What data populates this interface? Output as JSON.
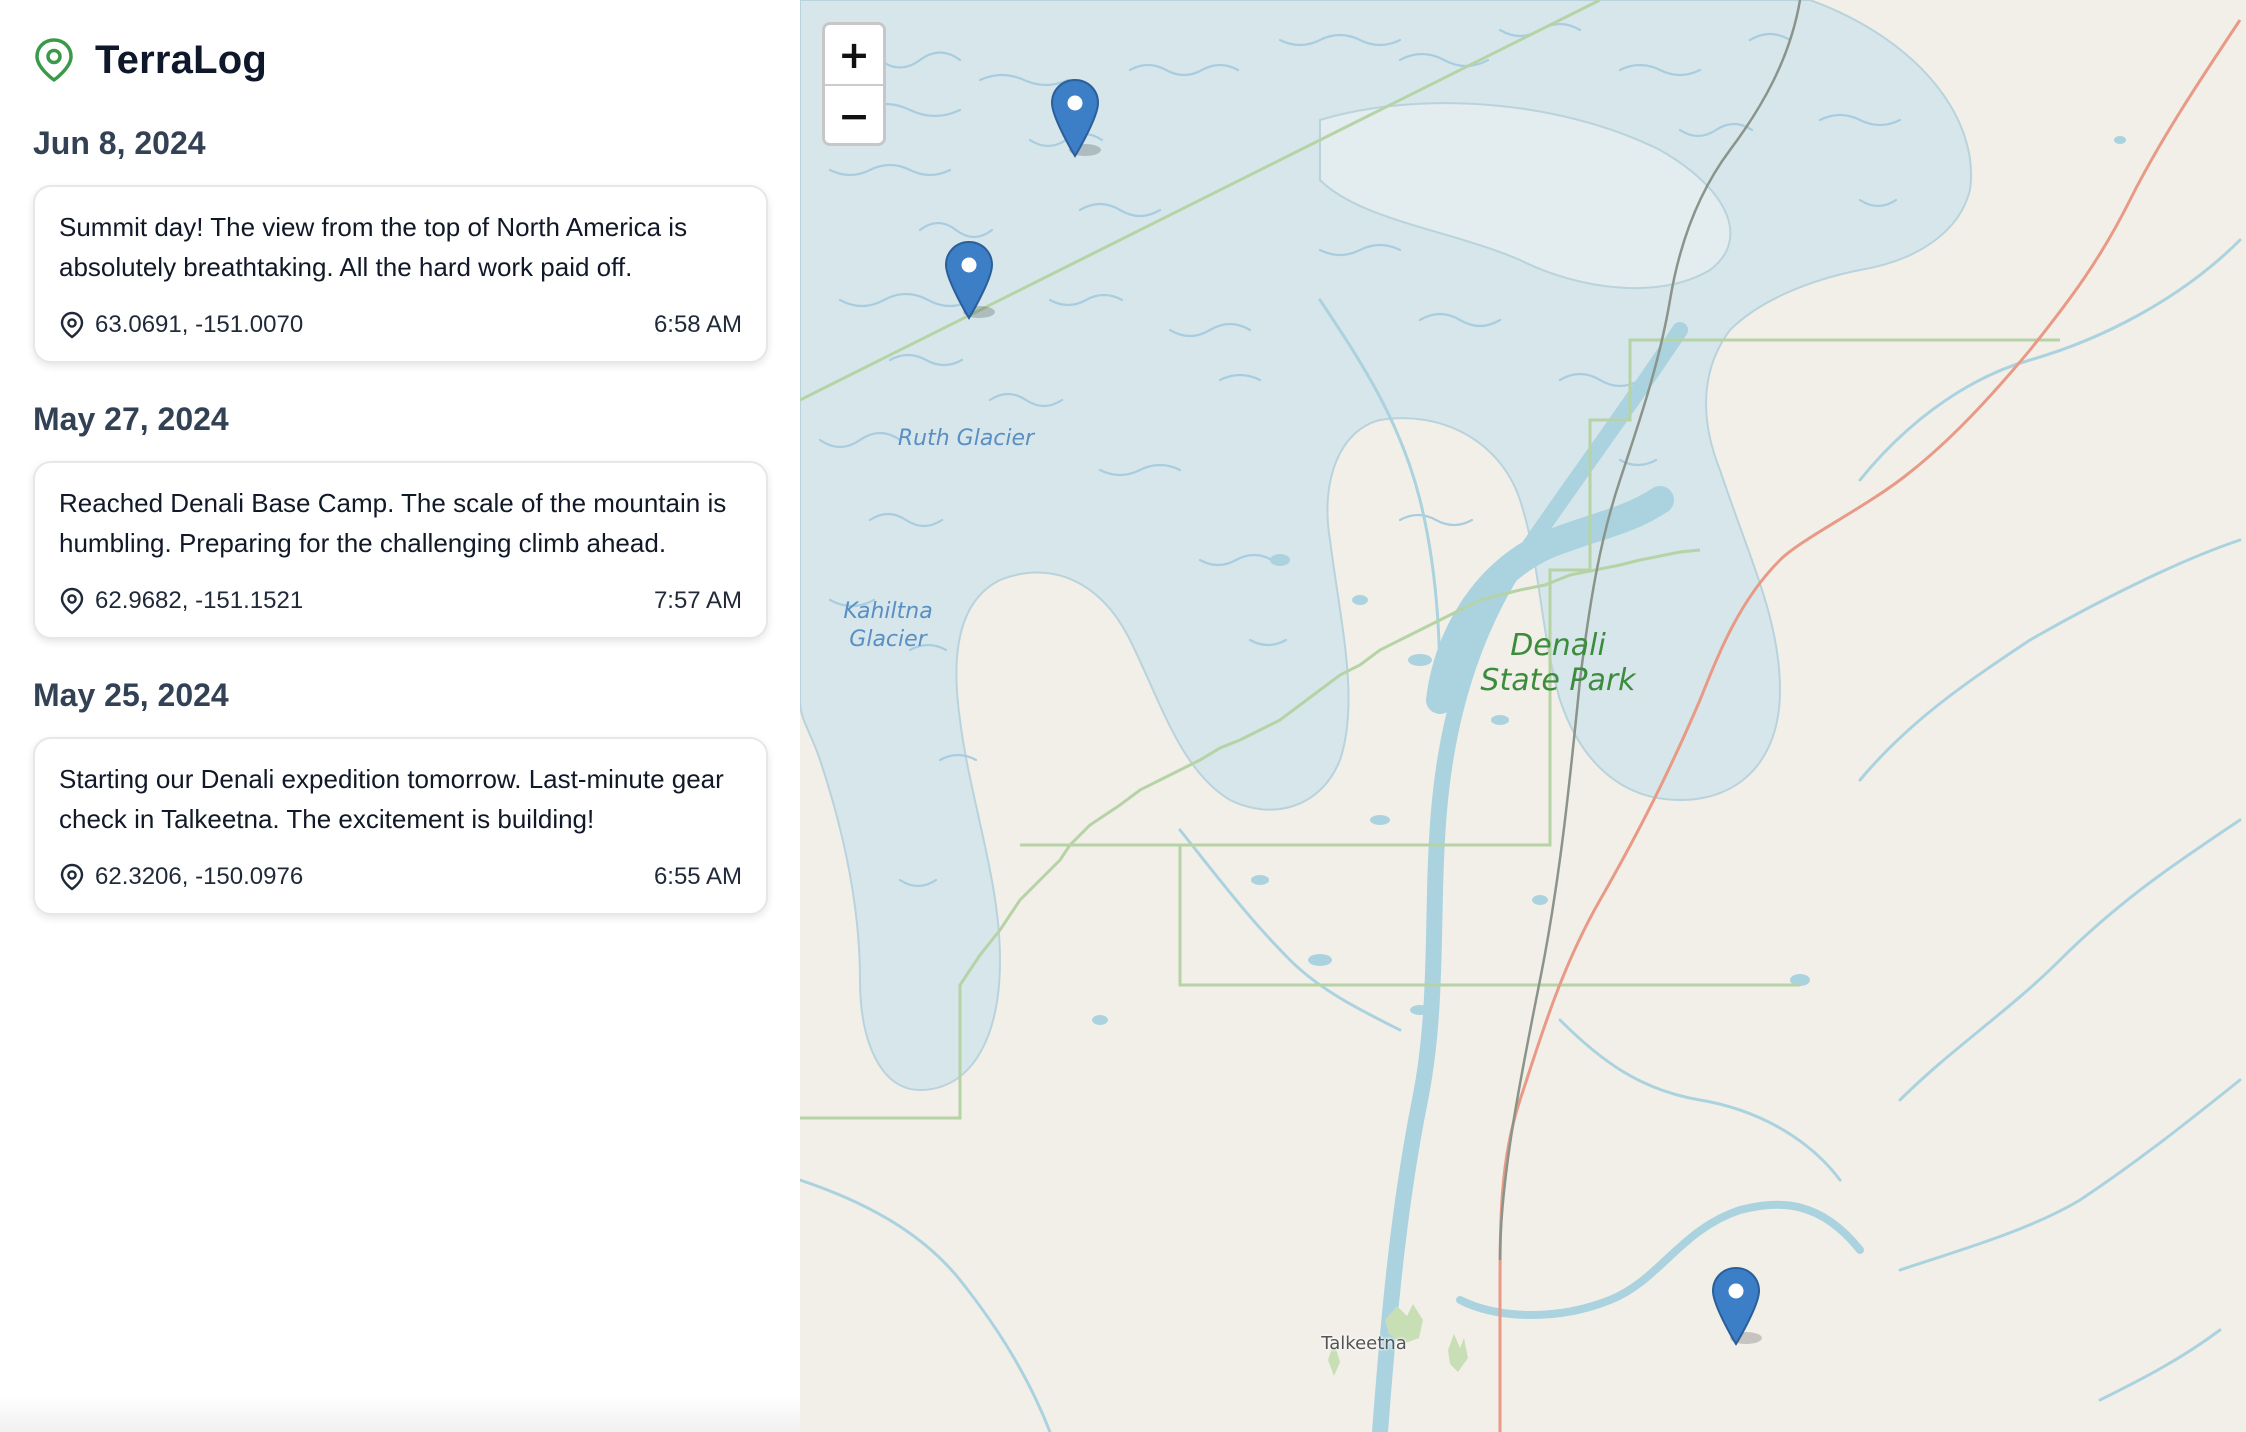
{
  "app": {
    "title": "TerraLog",
    "accent": "#3a9a4a"
  },
  "entries": [
    {
      "date": "Jun 8, 2024",
      "text": "Summit day! The view from the top of North America is absolutely breathtaking. All the hard work paid off.",
      "coords": "63.0691, -151.0070",
      "time": "6:58 AM"
    },
    {
      "date": "May 27, 2024",
      "text": "Reached Denali Base Camp. The scale of the mountain is humbling. Preparing for the challenging climb ahead.",
      "coords": "62.9682, -151.1521",
      "time": "7:57 AM"
    },
    {
      "date": "May 25, 2024",
      "text": "Starting our Denali expedition tomorrow. Last-minute gear check in Talkeetna. The excitement is building!",
      "coords": "62.3206, -150.0976",
      "time": "6:55 AM"
    }
  ],
  "map": {
    "zoom_in_label": "+",
    "zoom_out_label": "−",
    "labels": {
      "ruth_glacier": "Ruth Glacier",
      "kahiltna_line1": "Kahiltna",
      "kahiltna_line2": "Glacier",
      "park_line1": "Denali",
      "park_line2": "State Park",
      "town": "Talkeetna"
    },
    "marker_color": "#3d7fc6",
    "glacier_color": "#d6e6ea",
    "water_color": "#aad3df"
  }
}
